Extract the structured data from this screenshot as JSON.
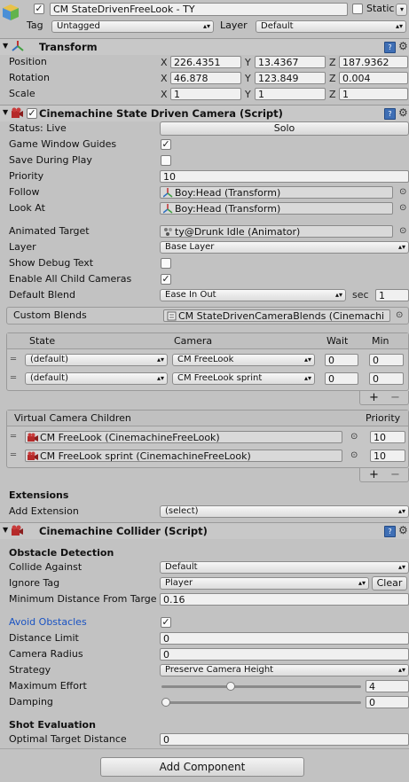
{
  "header": {
    "object_name": "CM StateDrivenFreeLook - TY",
    "static_label": "Static",
    "static_checked": false,
    "tag_label": "Tag",
    "tag_value": "Untagged",
    "layer_label": "Layer",
    "layer_value": "Default"
  },
  "transform": {
    "title": "Transform",
    "rows": [
      {
        "label": "Position",
        "x": "226.4351",
        "y": "13.4367",
        "z": "187.9362"
      },
      {
        "label": "Rotation",
        "x": "46.878",
        "y": "123.849",
        "z": "0.004"
      },
      {
        "label": "Scale",
        "x": "1",
        "y": "1",
        "z": "1"
      }
    ],
    "axis_x": "X",
    "axis_y": "Y",
    "axis_z": "Z"
  },
  "sdc": {
    "title": "Cinemachine State Driven Camera (Script)",
    "status": "Status: Live",
    "solo": "Solo",
    "game_window_guides": "Game Window Guides",
    "save_during_play": "Save During Play",
    "priority_label": "Priority",
    "priority_value": "10",
    "follow_label": "Follow",
    "follow_value": "Boy:Head (Transform)",
    "look_at_label": "Look At",
    "look_at_value": "Boy:Head (Transform)",
    "animated_target_label": "Animated Target",
    "animated_target_value": "ty@Drunk Idle (Animator)",
    "layer_label": "Layer",
    "layer_value": "Base Layer",
    "show_debug_text": "Show Debug Text",
    "enable_all_child": "Enable All Child Cameras",
    "default_blend_label": "Default Blend",
    "default_blend_value": "Ease In Out",
    "sec_label": "sec",
    "sec_value": "1",
    "custom_blends_label": "Custom Blends",
    "custom_blends_value": "CM StateDrivenCameraBlends (Cinemachi",
    "state_table": {
      "headers": [
        "State",
        "Camera",
        "Wait",
        "Min"
      ],
      "rows": [
        {
          "state": "(default)",
          "camera": "CM FreeLook",
          "wait": "0",
          "min": "0"
        },
        {
          "state": "(default)",
          "camera": "CM FreeLook sprint",
          "wait": "0",
          "min": "0"
        }
      ]
    },
    "children": {
      "title": "Virtual Camera Children",
      "priority_header": "Priority",
      "rows": [
        {
          "name": "CM FreeLook (CinemachineFreeLook)",
          "priority": "10"
        },
        {
          "name": "CM FreeLook sprint (CinemachineFreeLook)",
          "priority": "10"
        }
      ]
    },
    "extensions_title": "Extensions",
    "add_extension_label": "Add Extension",
    "add_extension_value": "(select)"
  },
  "collider": {
    "title": "Cinemachine Collider (Script)",
    "obstacle_detection": "Obstacle Detection",
    "collide_against_label": "Collide Against",
    "collide_against_value": "Default",
    "ignore_tag_label": "Ignore Tag",
    "ignore_tag_value": "Player",
    "clear": "Clear",
    "min_distance_label": "Minimum Distance From Targe",
    "min_distance_value": "0.16",
    "avoid_obstacles_label": "Avoid Obstacles",
    "distance_limit_label": "Distance Limit",
    "distance_limit_value": "0",
    "camera_radius_label": "Camera Radius",
    "camera_radius_value": "0",
    "strategy_label": "Strategy",
    "strategy_value": "Preserve Camera Height",
    "max_effort_label": "Maximum Effort",
    "max_effort_value": "4",
    "max_effort_fraction": 0.34,
    "damping_label": "Damping",
    "damping_value": "0",
    "damping_fraction": 0,
    "shot_evaluation": "Shot Evaluation",
    "optimal_label": "Optimal Target Distance",
    "optimal_value": "0"
  },
  "add_component": "Add Component",
  "colors": {
    "link_blue": "#1a53c2",
    "panel_grey": "#c2c2c2"
  }
}
